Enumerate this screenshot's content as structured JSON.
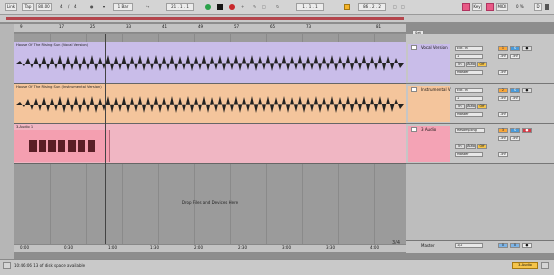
{
  "transport": {
    "link": "Link",
    "tap": "Tap",
    "tempo": "80.00",
    "sig_num": "4",
    "sig_den": "4",
    "metronome": "●",
    "quant": "1 Bar",
    "position": "21 . 1 . 1",
    "loop_start": "1 . 1 . 1",
    "loop_length": "86 . 2 . 2",
    "key": "Key",
    "midi": "MIDI",
    "cpu": "0 %",
    "d_button": "D"
  },
  "ruler": {
    "bars": [
      "9",
      "17",
      "25",
      "33",
      "41",
      "49",
      "57",
      "65",
      "73",
      "81"
    ],
    "times": [
      "0:00",
      "0:30",
      "1:00",
      "1:30",
      "2:00",
      "2:30",
      "3:00",
      "3:30",
      "4:00"
    ],
    "set_label": "Set"
  },
  "tracks": [
    {
      "clip_name": "House Of The Rising Sun (Vocal Version)",
      "name": "Vocal Version",
      "input": "Ext. In",
      "input_ch": "1",
      "monitor_opts": [
        "In",
        "Auto",
        "Off"
      ],
      "output": "Master",
      "sends": [
        "-inf",
        "-inf",
        "-inf"
      ],
      "number": "1",
      "color": "#b7a8dc",
      "clip_color": "#c9bde9"
    },
    {
      "clip_name": "House Of The Rising Sun (Instrumental Version)",
      "name": "Instrumental V",
      "input": "Ext. In",
      "input_ch": "1",
      "monitor_opts": [
        "In",
        "Auto",
        "Off"
      ],
      "output": "Master",
      "sends": [
        "-inf",
        "-inf",
        "-inf"
      ],
      "number": "2",
      "color": "#f0b27e",
      "clip_color": "#f4c59c"
    },
    {
      "clip_name": "3-Audio 1",
      "name": "3 Audio",
      "input": "Resampling",
      "input_ch": "",
      "monitor_opts": [
        "In",
        "Auto",
        "Off"
      ],
      "output": "Master",
      "sends": [
        "-inf",
        "-inf",
        "-inf"
      ],
      "number": "3",
      "color": "#f4a3b5",
      "clip_color": "#f0b6c3"
    }
  ],
  "drop_hint": "Drop Files and Devices Here",
  "master": {
    "name": "Master",
    "ch": "1/2",
    "value": "0",
    "number": "0"
  },
  "track_counter": "3/4",
  "status": {
    "message": "10:46:06 13 of disk space available",
    "right": "3-Audio"
  }
}
